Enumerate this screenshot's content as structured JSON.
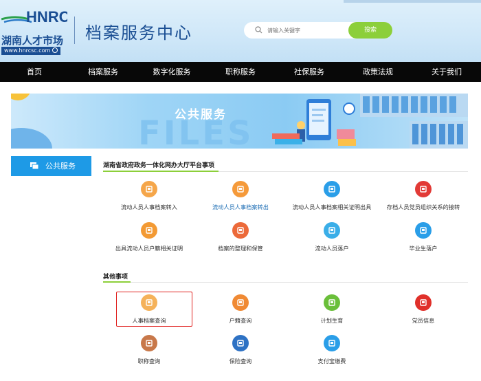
{
  "header": {
    "logo_cn": "湖南人才市场",
    "logo_url": "www.hnrcsc.com",
    "logo_mark": "HNRC",
    "site_title": "档案服务中心",
    "search_placeholder": "请输入关键字",
    "search_button": "搜索"
  },
  "nav": [
    "首页",
    "档案服务",
    "数字化服务",
    "职称服务",
    "社保服务",
    "政策法规",
    "关于我们"
  ],
  "banner": {
    "title": "公共服务",
    "watermark": "FILES"
  },
  "sidebar": {
    "label": "公共服务",
    "icon": "screen-icon"
  },
  "section1": {
    "title": "湖南省政府政务一体化网办大厅平台事项",
    "items": [
      {
        "label": "流动人员人事档案转入",
        "icon": "archive-in-icon",
        "color": "#f5a64a"
      },
      {
        "label": "流动人员人事档案转出",
        "icon": "archive-out-icon",
        "color": "#f59a3a"
      },
      {
        "label": "流动人员人事档案相关证明出具",
        "icon": "award-icon",
        "color": "#2a9ee8"
      },
      {
        "label": "存档人员党员组织关系的接转",
        "icon": "party-icon",
        "color": "#e23a36"
      },
      {
        "label": "出具流动人员户籍相关证明",
        "icon": "id-card-icon",
        "color": "#f39a34"
      },
      {
        "label": "档案的整理和保管",
        "icon": "image-icon",
        "color": "#ec6a3a"
      },
      {
        "label": "流动人员落户",
        "icon": "person-check-icon",
        "color": "#3aaee8"
      },
      {
        "label": "毕业生落户",
        "icon": "graduate-icon",
        "color": "#2a9ee8"
      }
    ]
  },
  "section2": {
    "title": "其他事项",
    "items": [
      {
        "label": "人事档案查询",
        "icon": "folder-icon",
        "color": "#f5b25a"
      },
      {
        "label": "户籍查询",
        "icon": "id-card-icon",
        "color": "#f08a34"
      },
      {
        "label": "计划生育",
        "icon": "family-icon",
        "color": "#6abf3a"
      },
      {
        "label": "党员信息",
        "icon": "party-icon",
        "color": "#e0302a"
      },
      {
        "label": "职称查询",
        "icon": "person-card-icon",
        "color": "#c8784a"
      },
      {
        "label": "保险查询",
        "icon": "shield-person-icon",
        "color": "#2e72c4"
      },
      {
        "label": "支付宝缴费",
        "icon": "alipay-icon",
        "color": "#2a9ee8"
      }
    ]
  }
}
